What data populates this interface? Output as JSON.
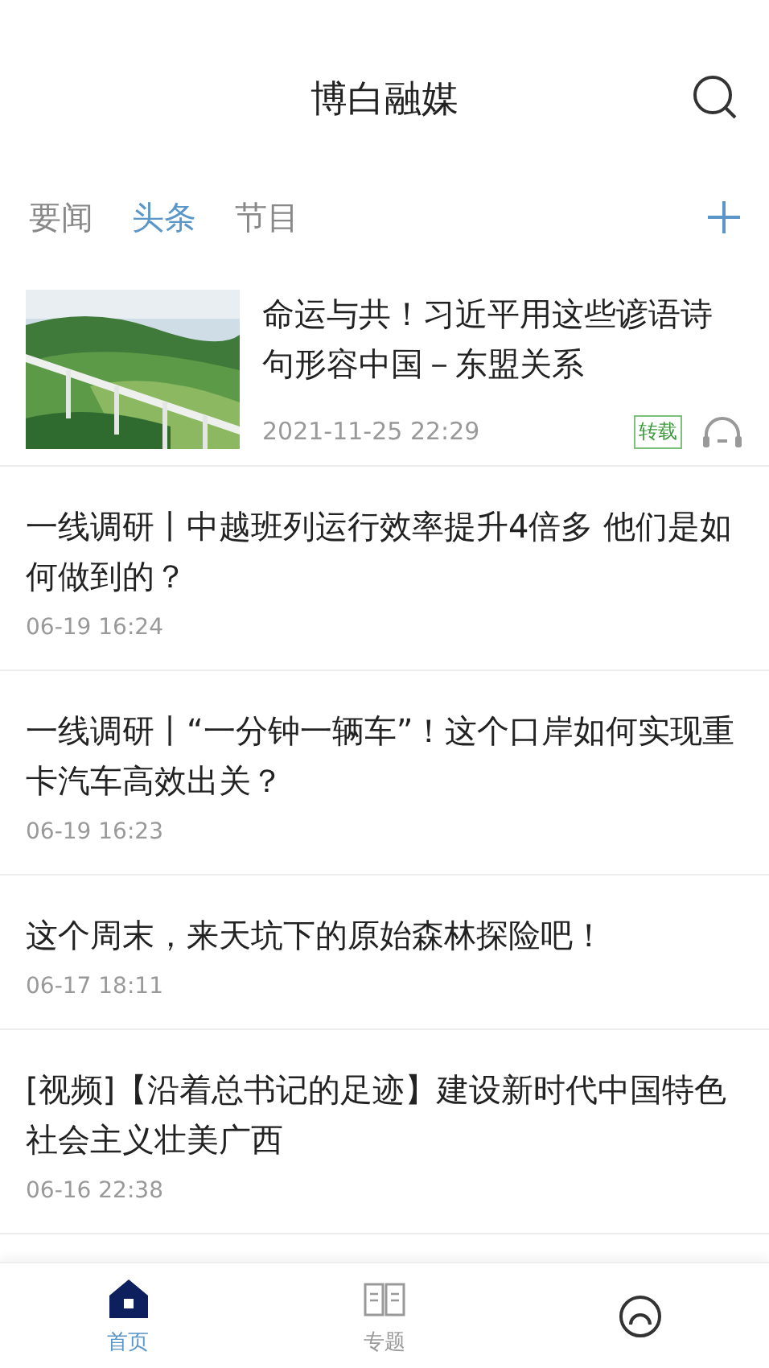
{
  "header": {
    "title": "博白融媒"
  },
  "tabs": [
    {
      "label": "要闻",
      "selected": false
    },
    {
      "label": "头条",
      "selected": true
    },
    {
      "label": "节目",
      "selected": false
    }
  ],
  "articles": [
    {
      "kind": "featured",
      "title": "命运与共！习近平用这些谚语诗句形容中国－东盟关系",
      "time": "2021-11-25 22:29",
      "tag": "转载"
    },
    {
      "kind": "text",
      "title": "一线调研丨中越班列运行效率提升4倍多 他们是如何做到的？",
      "time": "06-19 16:24"
    },
    {
      "kind": "text",
      "title": "一线调研丨“一分钟一辆车”！这个口岸如何实现重卡汽车高效出关？",
      "time": "06-19 16:23"
    },
    {
      "kind": "text",
      "title": "这个周末，来天坑下的原始森林探险吧！",
      "time": "06-17 18:11"
    },
    {
      "kind": "text",
      "title": "[视频]【沿着总书记的足迹】建设新时代中国特色社会主义壮美广西",
      "time": "06-16 22:38"
    }
  ],
  "bottom_nav": [
    {
      "kind": "home",
      "label": "首页",
      "selected": true
    },
    {
      "kind": "topics",
      "label": "专题",
      "selected": false
    },
    {
      "kind": "profile",
      "selected": false
    }
  ]
}
